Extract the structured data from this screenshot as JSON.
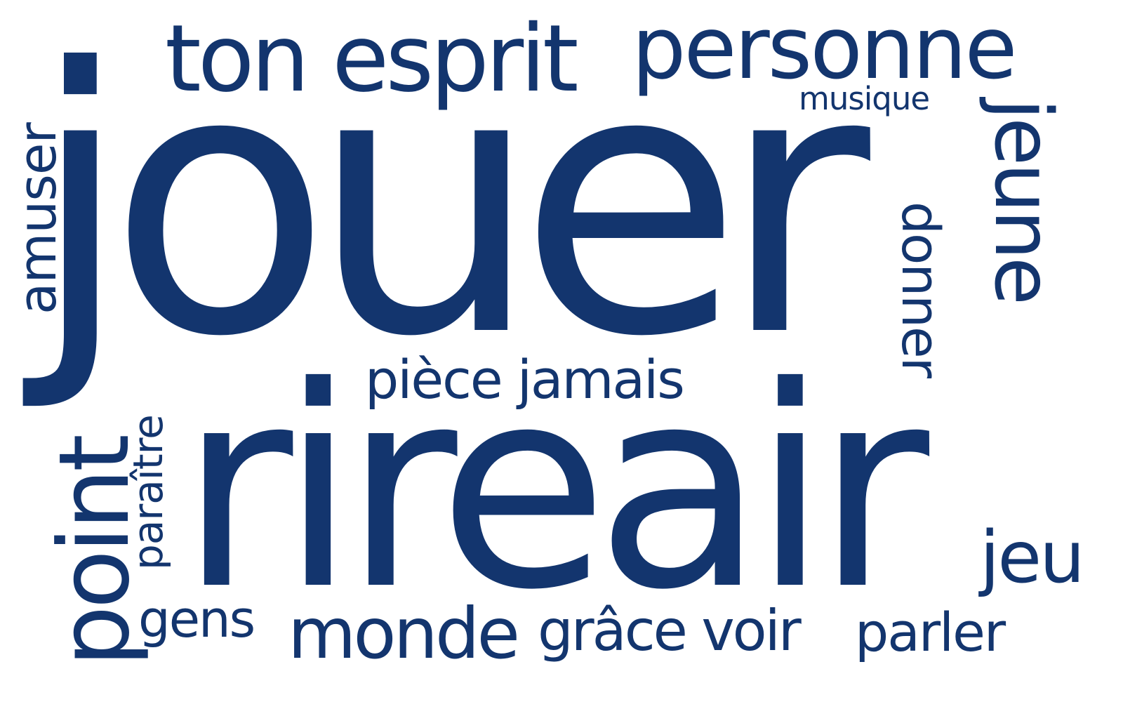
{
  "theme": {
    "text_color": "#13356e",
    "background": "#ffffff"
  },
  "cloud": {
    "words": [
      {
        "text": "jouer",
        "weight": 1.0
      },
      {
        "text": "rireair",
        "weight": 0.76
      },
      {
        "text": "ton esprit",
        "weight": 0.25
      },
      {
        "text": "personne",
        "weight": 0.23
      },
      {
        "text": "musique",
        "weight": 0.09
      },
      {
        "text": "amuser",
        "weight": 0.14
      },
      {
        "text": "jeune",
        "weight": 0.21
      },
      {
        "text": "donner",
        "weight": 0.14
      },
      {
        "text": "pièce jamais",
        "weight": 0.15
      },
      {
        "text": "point",
        "weight": 0.27
      },
      {
        "text": "paraître",
        "weight": 0.11
      },
      {
        "text": "jeu",
        "weight": 0.19
      },
      {
        "text": "gens",
        "weight": 0.14
      },
      {
        "text": "monde",
        "weight": 0.19
      },
      {
        "text": "grâce voir",
        "weight": 0.15
      },
      {
        "text": "parler",
        "weight": 0.15
      }
    ]
  }
}
